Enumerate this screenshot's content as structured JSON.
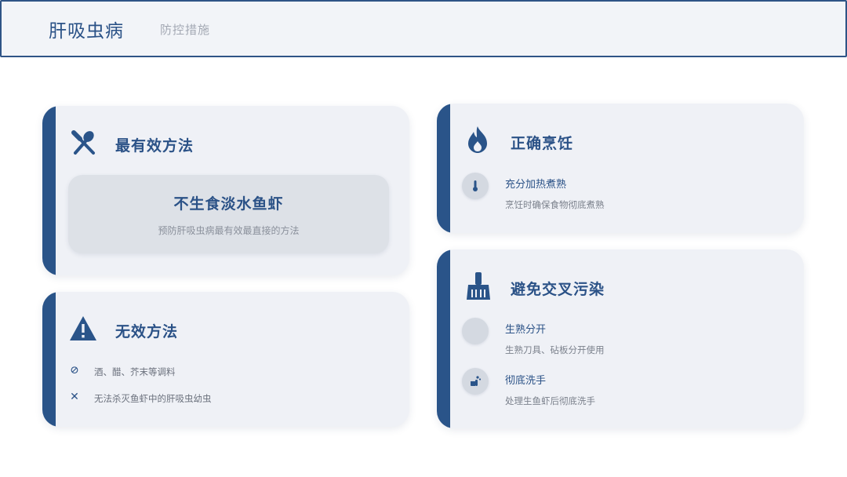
{
  "header": {
    "title": "肝吸虫病",
    "subtitle": "防控措施"
  },
  "cards": {
    "effective": {
      "icon": "utensils-icon",
      "title": "最有效方法",
      "highlight": {
        "title": "不生食淡水鱼虾",
        "desc": "预防肝吸虫病最有效最直接的方法"
      }
    },
    "invalid": {
      "icon": "warning-icon",
      "title": "无效方法",
      "items": [
        {
          "icon": "ban-icon",
          "glyph": "⊘",
          "text": "酒、醋、芥末等调料"
        },
        {
          "icon": "times-icon",
          "glyph": "✕",
          "text": "无法杀灭鱼虾中的肝吸虫幼虫"
        }
      ]
    },
    "cook": {
      "icon": "fire-icon",
      "title": "正确烹饪",
      "items": [
        {
          "icon": "thermometer-icon",
          "title": "充分加热煮熟",
          "desc": "烹饪时确保食物彻底煮熟"
        }
      ]
    },
    "cross": {
      "icon": "broom-icon",
      "title": "避免交叉污染",
      "items": [
        {
          "icon": "blank-icon",
          "title": "生熟分开",
          "desc": "生熟刀具、砧板分开使用"
        },
        {
          "icon": "hand-wash-icon",
          "title": "彻底洗手",
          "desc": "处理生鱼虾后彻底洗手"
        }
      ]
    }
  },
  "colors": {
    "accent": "#2a5489",
    "card_bg": "#eff1f6",
    "highlight_bg": "#dde1e7",
    "muted_text": "#8a909b"
  }
}
